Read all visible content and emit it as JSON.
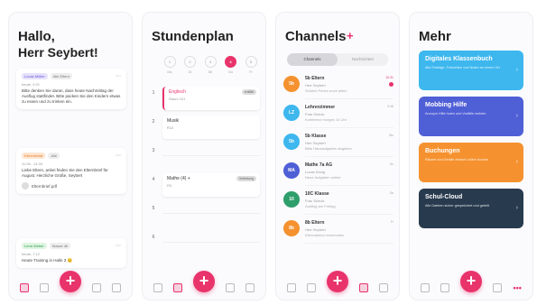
{
  "colors": {
    "accent": "#e8336b",
    "blue": "#3db7ee",
    "indigo": "#4f5fd6",
    "orange": "#f5922f",
    "navy": "#283a4e"
  },
  "screen1": {
    "title": "Hallo,",
    "subtitle": "Herr Seybert!",
    "cards": [
      {
        "tag1": "Lucas Müller",
        "tag2": "Alle Eltern",
        "meta": "heute, 9:21",
        "body": "Bitte denken Sie daran, dass heute Nachmittag der Ausflug stattfindet. Bitte packen Sie den Kindern etwas zu essen und zu trinken ein."
      },
      {
        "tag1": "Elternbeirat",
        "tag2": "Alle",
        "meta": "11.06., 14:34",
        "body": "Liebe Eltern, anbei finden Sie den Elternbrief für August. Herzliche Grüße, Seybert",
        "attachment": "Elternbrief.pdf"
      },
      {
        "tag1": "Lena Weber",
        "tag2": "Klasse 4b",
        "meta": "heute, 7:12",
        "body": "Heute Training in Halle 3 😊"
      }
    ],
    "fab": "+"
  },
  "screen2": {
    "title": "Stundenplan",
    "days": [
      {
        "abbr": "Mo",
        "num": "1"
      },
      {
        "abbr": "Di",
        "num": "2"
      },
      {
        "abbr": "Mi",
        "num": "3"
      },
      {
        "abbr": "Do",
        "num": "4"
      },
      {
        "abbr": "Fr",
        "num": "5"
      }
    ],
    "lessons": [
      {
        "num": "1",
        "name": "Englisch",
        "room": "Raum 101",
        "badge": "entfällt"
      },
      {
        "num": "2",
        "name": "Musik",
        "room": "R12",
        "badge": ""
      },
      {
        "num": "3",
        "name": "",
        "room": "",
        "badge": ""
      },
      {
        "num": "4",
        "name": "Mathe (4) +",
        "room": "R3",
        "badge": "Vertretung"
      },
      {
        "num": "5",
        "name": "",
        "room": "",
        "badge": ""
      },
      {
        "num": "6",
        "name": "",
        "room": "",
        "badge": ""
      }
    ],
    "fab": "+"
  },
  "screen3": {
    "title": "Channels",
    "plus": "+",
    "segments": [
      "Channels",
      "Nachrichten"
    ],
    "channels": [
      {
        "name": "5b Eltern",
        "sub": "Herr Seybert",
        "msg": "Schöne Ferien euch allen!",
        "time": "10:31",
        "unread": true,
        "color": "#f5922f",
        "initials": "5b"
      },
      {
        "name": "Lehrerzimmer",
        "sub": "Frau Schulz",
        "msg": "Konferenz morgen 14 Uhr",
        "time": "9:48",
        "unread": false,
        "color": "#3db7ee",
        "initials": "LZ"
      },
      {
        "name": "5b Klasse",
        "sub": "Herr Seybert",
        "msg": "Bitte Hausaufgaben abgeben",
        "time": "Mo",
        "unread": false,
        "color": "#3db7ee",
        "initials": "5b"
      },
      {
        "name": "Mathe 7a AG",
        "sub": "Lucas König",
        "msg": "Neue Aufgaben online",
        "time": "So",
        "unread": false,
        "color": "#4f5fd6",
        "initials": "MA"
      },
      {
        "name": "10C Klasse",
        "sub": "Frau Schulz",
        "msg": "Ausflug am Freitag",
        "time": "Sa",
        "unread": false,
        "color": "#2e9e6a",
        "initials": "10"
      },
      {
        "name": "8b Eltern",
        "sub": "Herr Seybert",
        "msg": "Elternabend verschoben",
        "time": "Fr",
        "unread": false,
        "color": "#f5922f",
        "initials": "8b"
      }
    ],
    "fab": "+"
  },
  "screen4": {
    "title": "Mehr",
    "tiles": [
      {
        "title": "Digitales Klassenbuch",
        "desc": "Alle Einträge, Fehlzeiten und Noten an einem Ort",
        "color": "#3db7ee"
      },
      {
        "title": "Mobbing Hilfe",
        "desc": "Anonym Hilfe holen und Vorfälle melden",
        "color": "#4f5fd6"
      },
      {
        "title": "Buchungen",
        "desc": "Räume und Geräte einfach online buchen",
        "color": "#f5922f"
      },
      {
        "title": "Schul-Cloud",
        "desc": "Alle Dateien sicher gespeichert und geteilt",
        "color": "#283a4e"
      }
    ],
    "fab": "+",
    "more": "•••"
  }
}
